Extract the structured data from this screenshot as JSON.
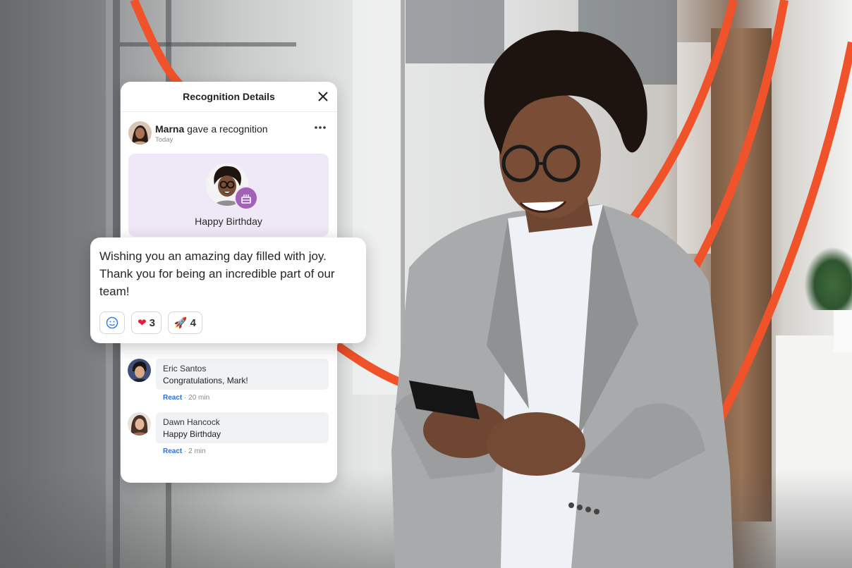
{
  "card": {
    "title": "Recognition Details",
    "giver_name": "Marna",
    "giver_action": "gave a recognition",
    "giver_time": "Today",
    "award_label": "Happy Birthday"
  },
  "message": {
    "text": "Wishing you an amazing day filled with joy. Thank you for being an incredible part of our team!",
    "reactions": [
      {
        "icon": "heart-emoji",
        "glyph": "❤",
        "count": "3",
        "color": "#e0203a"
      },
      {
        "icon": "rocket-emoji",
        "glyph": "🚀",
        "count": "4",
        "color": "#6a5acd"
      }
    ]
  },
  "comments": [
    {
      "name": "Eric Santos",
      "text": "Congratulations, Mark!",
      "react_label": "React",
      "time": "20 min"
    },
    {
      "name": "Dawn Hancock",
      "text": "Happy Birthday",
      "react_label": "React",
      "time": "2 min"
    }
  ],
  "colors": {
    "accent_arc": "#f0522a",
    "link": "#2f6fd0",
    "celebration_bg": "#efe8f7",
    "badge": "#a262b8"
  }
}
